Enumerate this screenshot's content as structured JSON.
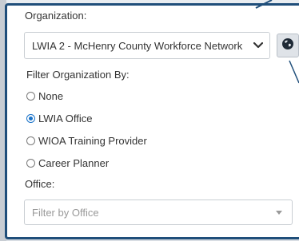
{
  "organization": {
    "label": "Organization:",
    "selected": "LWIA 2 - McHenry County Workforce Network",
    "globe_icon": "globe-icon",
    "chevron_icon": "chevron-down-icon"
  },
  "filter": {
    "label": "Filter Organization By:",
    "options": [
      {
        "label": "None",
        "selected": false
      },
      {
        "label": "LWIA Office",
        "selected": true
      },
      {
        "label": "WIOA Training Provider",
        "selected": false
      },
      {
        "label": "Career Planner",
        "selected": false
      }
    ]
  },
  "office": {
    "label": "Office:",
    "placeholder": "Filter by Office"
  },
  "colors": {
    "panel_border": "#1f4e7a",
    "radio_selected": "#1a73c9"
  }
}
